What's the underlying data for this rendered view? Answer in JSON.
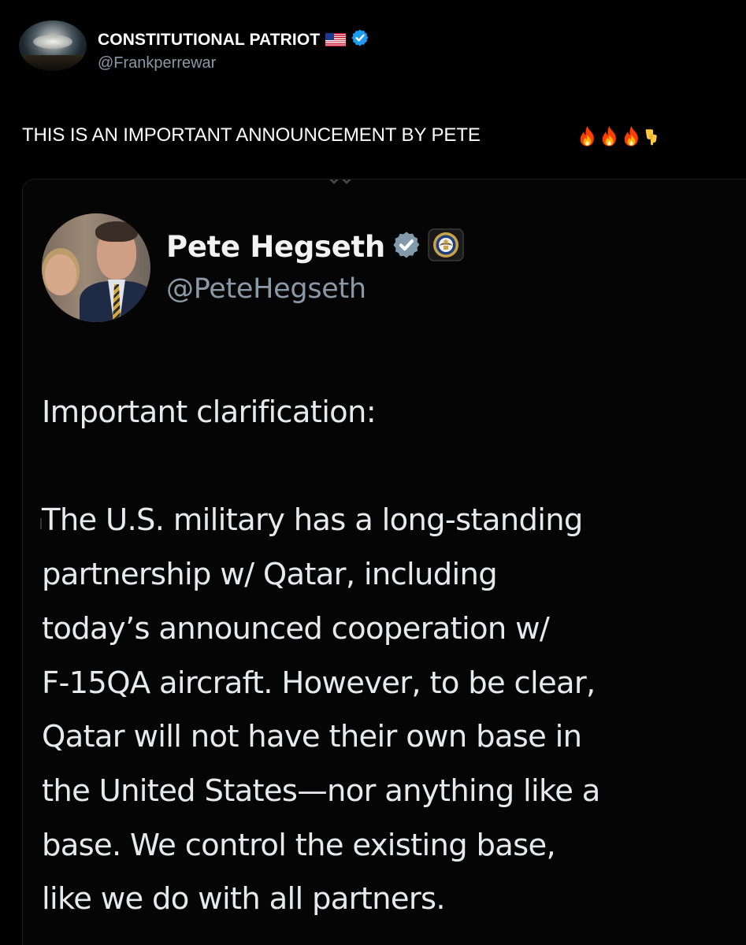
{
  "outer_post": {
    "author_name": "CONSTITUTIONAL PATRIOT",
    "author_handle": "@Frankperrewar",
    "verified": true,
    "flag_emoji": "us-flag-icon",
    "text": "THIS IS AN IMPORTANT ANNOUNCEMENT BY PETE",
    "emojis": [
      "fire-icon",
      "fire-icon",
      "fire-icon",
      "pointing-down-icon"
    ]
  },
  "embedded_post": {
    "author_name": "Pete Hegseth",
    "author_handle": "@PeteHegseth",
    "verified": true,
    "affiliation_badge": "department-of-defense-seal-icon",
    "heading": "Important clarification:",
    "body_lines": [
      "The U.S. military has a long-standing",
      "partnership w/ Qatar, including",
      "today’s announced cooperation w/",
      "F-15QA aircraft. However, to be clear,",
      "Qatar will not have their own base in",
      "the United States—nor anything like a",
      "base. We control the existing base,",
      "like we do with all partners."
    ]
  },
  "colors": {
    "background": "#000000",
    "primary_text": "#e7e9ea",
    "secondary_text": "#8b98a5",
    "verified_blue": "#1d9bf0",
    "verified_grey": "#829aab"
  }
}
